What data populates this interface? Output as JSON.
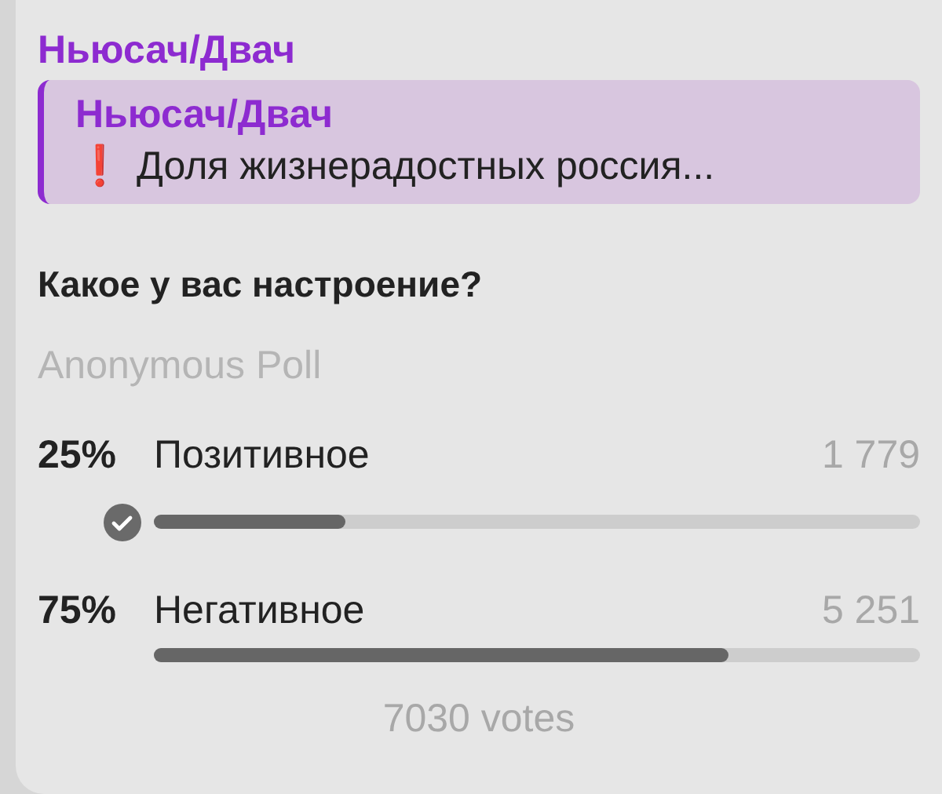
{
  "message": {
    "sender": "Ньюсач/Двач",
    "reply": {
      "title": "Ньюсач/Двач",
      "icon": "❗",
      "text": "Доля жизнерадостных россия..."
    },
    "poll": {
      "question": "Какое у вас настроение?",
      "type": "Anonymous Poll",
      "options": [
        {
          "percent": "25%",
          "label": "Позитивное",
          "count": "1 779",
          "level": 0.25,
          "selected": true
        },
        {
          "percent": "75%",
          "label": "Негативное",
          "count": "5 251",
          "level": 0.75,
          "selected": false
        }
      ],
      "total": "7030 votes"
    }
  }
}
